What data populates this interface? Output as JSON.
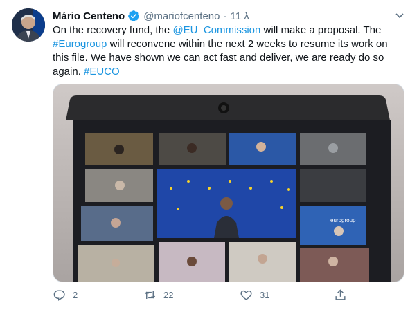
{
  "tweet": {
    "author_name": "Mário Centeno",
    "handle": "@mariofcenteno",
    "separator": "·",
    "time": "11 λ",
    "text_parts": {
      "p1": "On the recovery fund, the ",
      "mention": "@EU_Commission",
      "p2": " will make a proposal. The ",
      "hashtag1": "#Eurogroup",
      "p3": " will reconvene within the next 2 weeks to resume its work on this file. We have shown we can act fast and deliver, we are ready do so again. ",
      "hashtag2": "#EUCO"
    },
    "media": {
      "screen_label": "eurogroup"
    }
  },
  "actions": {
    "replies": "2",
    "retweets": "22",
    "likes": "31"
  },
  "colors": {
    "link": "#1b95e0",
    "icon_gray": "#5b7083",
    "verified": "#1da1f2"
  }
}
